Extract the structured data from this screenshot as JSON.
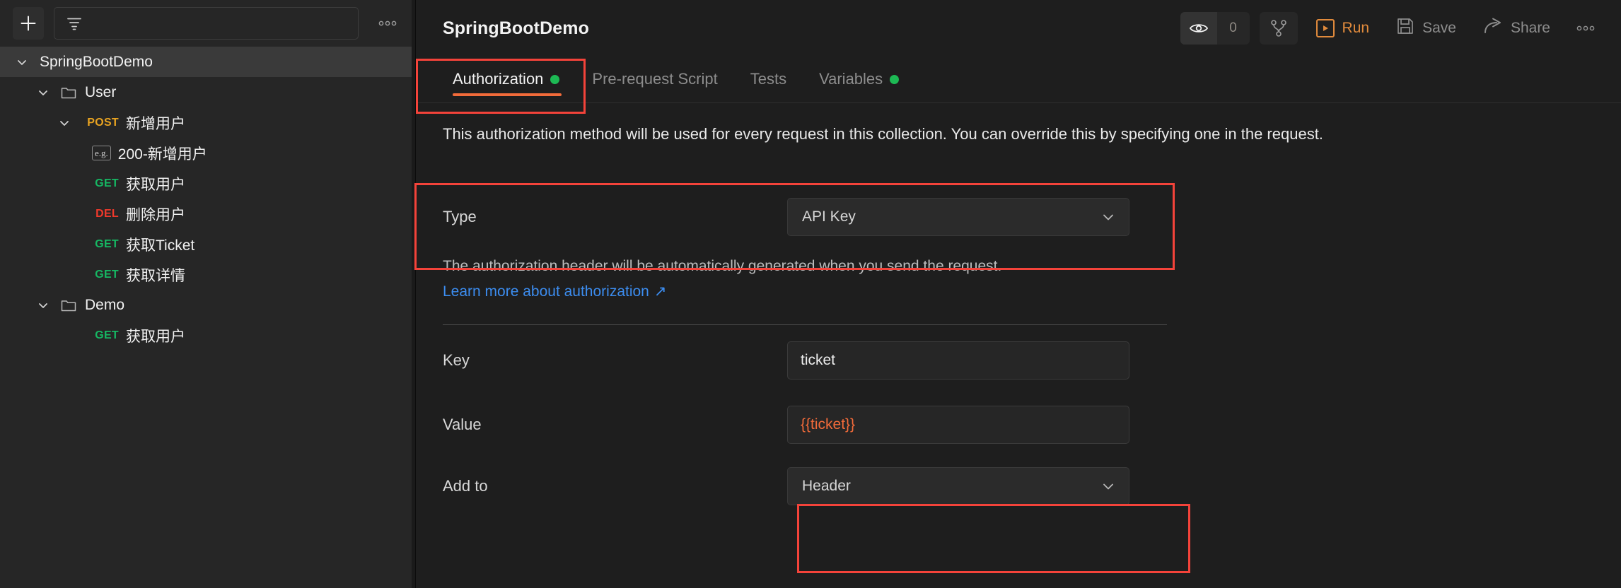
{
  "sidebar": {
    "add_button_label": "+",
    "search": {
      "placeholder": "",
      "value": ""
    },
    "more_label": "•••",
    "tree": [
      {
        "label": "SpringBootDemo",
        "type": "collection",
        "indent": 1,
        "selected": true,
        "expanded": true
      },
      {
        "label": "User",
        "type": "folder",
        "indent": 2,
        "expanded": true
      },
      {
        "label": "新增用户",
        "type": "request",
        "method": "POST",
        "indent": 3,
        "expanded": true
      },
      {
        "label": "200-新增用户",
        "type": "example",
        "badge": "e.g.",
        "indent": 4
      },
      {
        "label": "获取用户",
        "type": "request",
        "method": "GET",
        "indent": 3
      },
      {
        "label": "删除用户",
        "type": "request",
        "method": "DEL",
        "indent": 3
      },
      {
        "label": "获取Ticket",
        "type": "request",
        "method": "GET",
        "indent": 3
      },
      {
        "label": "获取详情",
        "type": "request",
        "method": "GET",
        "indent": 3
      },
      {
        "label": "Demo",
        "type": "folder",
        "indent": 2,
        "expanded": true
      },
      {
        "label": "获取用户",
        "type": "request",
        "method": "GET",
        "indent": 3
      }
    ]
  },
  "header": {
    "title": "SpringBootDemo",
    "watch_count": "0",
    "run_label": "Run",
    "save_label": "Save",
    "share_label": "Share",
    "more_label": "•••"
  },
  "tabs": [
    {
      "label": "Authorization",
      "active": true,
      "dot": true
    },
    {
      "label": "Pre-request Script",
      "active": false,
      "dot": false
    },
    {
      "label": "Tests",
      "active": false,
      "dot": false
    },
    {
      "label": "Variables",
      "active": false,
      "dot": true
    }
  ],
  "auth": {
    "description": "This authorization method will be used for every request in this collection. You can override this by specifying one in the request.",
    "type_label": "Type",
    "type_value": "API Key",
    "note": "The authorization header will be automatically generated when you send the request.",
    "link_text": "Learn more about authorization",
    "link_arrow": "↗",
    "key_label": "Key",
    "key_value": "ticket",
    "value_label": "Value",
    "value_value": "{{ticket}}",
    "addto_label": "Add to",
    "addto_value": "Header"
  },
  "colors": {
    "accent_orange": "#f26b3a",
    "highlight_red": "#f4433a",
    "method_post": "#e8a321",
    "method_get": "#16b763",
    "method_del": "#f0392b",
    "link_blue": "#3c8df0",
    "status_dot_green": "#1db954"
  }
}
